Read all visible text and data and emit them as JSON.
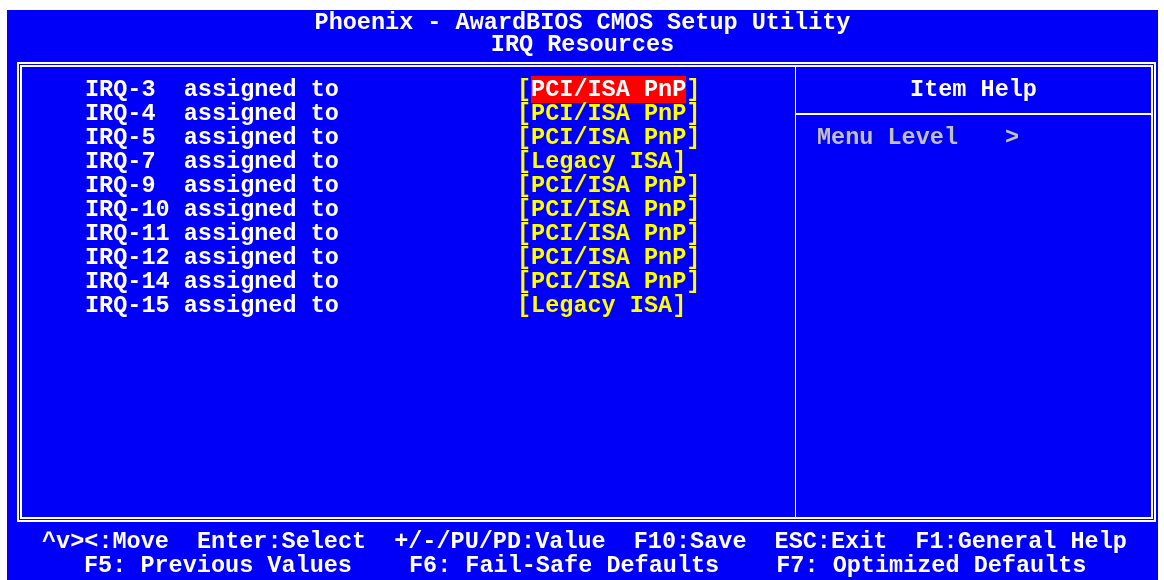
{
  "title": [
    "Phoenix - AwardBIOS CMOS Setup Utility",
    "IRQ Resources"
  ],
  "settings": [
    {
      "label": "IRQ-3  assigned to",
      "value": "[PCI/ISA PnP]",
      "selected": true
    },
    {
      "label": "IRQ-4  assigned to",
      "value": "[PCI/ISA PnP]",
      "selected": false
    },
    {
      "label": "IRQ-5  assigned to",
      "value": "[PCI/ISA PnP]",
      "selected": false
    },
    {
      "label": "IRQ-7  assigned to",
      "value": "[Legacy ISA]",
      "selected": false
    },
    {
      "label": "IRQ-9  assigned to",
      "value": "[PCI/ISA PnP]",
      "selected": false
    },
    {
      "label": "IRQ-10 assigned to",
      "value": "[PCI/ISA PnP]",
      "selected": false
    },
    {
      "label": "IRQ-11 assigned to",
      "value": "[PCI/ISA PnP]",
      "selected": false
    },
    {
      "label": "IRQ-12 assigned to",
      "value": "[PCI/ISA PnP]",
      "selected": false
    },
    {
      "label": "IRQ-14 assigned to",
      "value": "[PCI/ISA PnP]",
      "selected": false
    },
    {
      "label": "IRQ-15 assigned to",
      "value": "[Legacy ISA]",
      "selected": false
    }
  ],
  "item_help": {
    "title": "Item Help",
    "menu_level_label": "Menu Level",
    "menu_level_value": ">"
  },
  "footer": [
    [
      "^v><:Move",
      "Enter:Select",
      "+/-/PU/PD:Value",
      "F10:Save",
      "ESC:Exit",
      "F1:General Help"
    ],
    [
      "F5: Previous Values",
      "F6: Fail-Safe Defaults",
      "F7: Optimized Defaults"
    ]
  ]
}
